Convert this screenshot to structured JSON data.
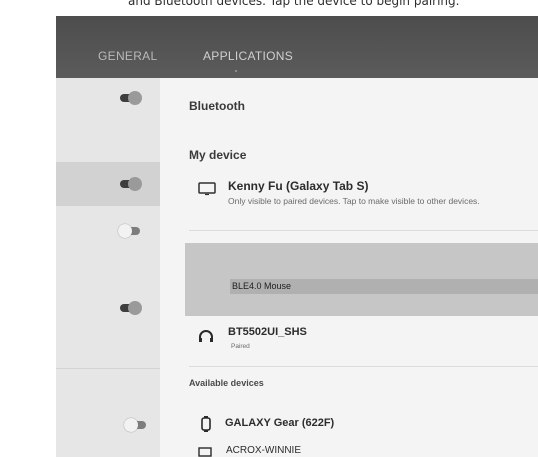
{
  "caption": {
    "text": "and Bluetooth devices. Tap the device to begin pairing."
  },
  "tabs": [
    {
      "label": "GENERAL"
    },
    {
      "label": "APPLICATIONS"
    }
  ],
  "sidebar": {
    "toggles": [
      {
        "state": "on"
      },
      {
        "state": "on"
      },
      {
        "state": "off"
      },
      {
        "state": "on"
      },
      {
        "state": "off"
      }
    ]
  },
  "bluetooth": {
    "title": "Bluetooth",
    "my_device_header": "My device",
    "my_device": {
      "name": "Kenny Fu (Galaxy Tab S)",
      "subtitle": "Only visible to paired devices. Tap to make visible to other devices.",
      "icon": "tablet-icon"
    },
    "highlighted_device": {
      "name": "BLE4.0 Mouse"
    },
    "paired_devices": [
      {
        "name": "BT5502UI_SHS",
        "status": "Paired",
        "icon": "headphones-icon"
      }
    ],
    "available_header": "Available devices",
    "available_devices": [
      {
        "name": "GALAXY Gear (622F)",
        "icon": "watch-icon"
      },
      {
        "name": "ACROX-WINNIE",
        "icon": "laptop-icon"
      }
    ]
  },
  "colors": {
    "appbar": "#555555",
    "sidebar": "#e6e6e6",
    "content": "#f4f4f4",
    "highlight_block": "#c6c6c6"
  }
}
